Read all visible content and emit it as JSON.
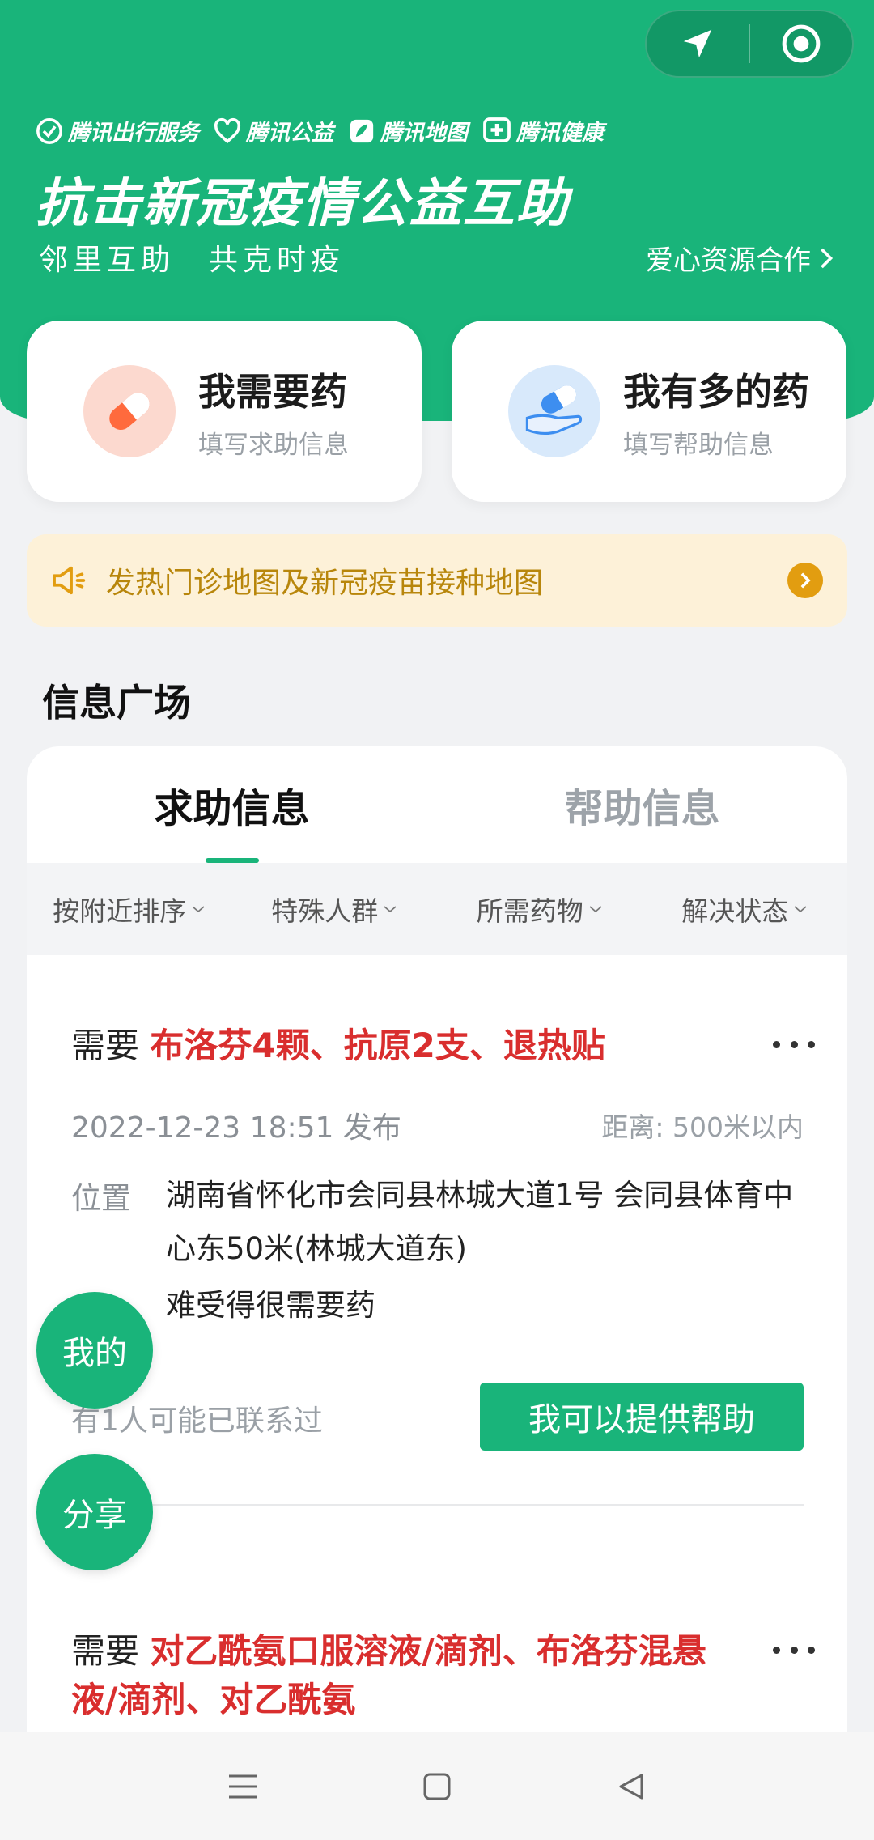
{
  "header": {
    "brands": [
      {
        "label": "腾讯出行服务",
        "icon": "checkmark-circle-icon"
      },
      {
        "label": "腾讯公益",
        "icon": "heart-icon"
      },
      {
        "label": "腾讯地图",
        "icon": "leaf-map-icon"
      },
      {
        "label": "腾讯健康",
        "icon": "medical-cross-icon"
      }
    ],
    "title": "抗击新冠疫情公益互助",
    "subtitle": "邻里互助　共克时疫",
    "partner_link": "爱心资源合作",
    "capsule_icons": [
      "location-arrow-icon",
      "record-target-icon"
    ]
  },
  "actions": {
    "need": {
      "title": "我需要药",
      "subtitle": "填写求助信息"
    },
    "have": {
      "title": "我有多的药",
      "subtitle": "填写帮助信息"
    }
  },
  "notice": {
    "text": "发热门诊地图及新冠疫苗接种地图"
  },
  "section_title": "信息广场",
  "tabs": [
    {
      "label": "求助信息",
      "active": true
    },
    {
      "label": "帮助信息",
      "active": false
    }
  ],
  "filters": [
    "按附近排序",
    "特殊人群",
    "所需药物",
    "解决状态"
  ],
  "posts": [
    {
      "need_label": "需要",
      "meds": "布洛芬4颗、抗原2支、退热贴",
      "date": "2022-12-23 18:51 发布",
      "distance": "距离: 500米以内",
      "location_label": "位置",
      "location": "湖南省怀化市会同县林城大道1号 会同县体育中心东50米(林城大道东)",
      "description": "难受得很需要药",
      "contact_note": "有1人可能已联系过",
      "help_button": "我可以提供帮助"
    },
    {
      "need_label": "需要",
      "meds": "对乙酰氨口服溶液/滴剂、布洛芬混悬液/滴剂、对乙酰氨"
    }
  ],
  "floating": {
    "mine": "我的",
    "share": "分享"
  },
  "colors": {
    "primary": "#19b47a",
    "urgent": "#d92e2e",
    "notice_text": "#b8860b"
  }
}
